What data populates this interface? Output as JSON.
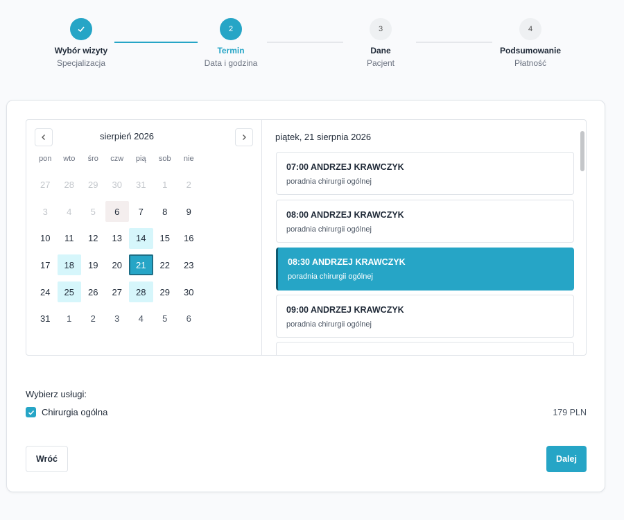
{
  "stepper": {
    "steps": [
      {
        "number": "",
        "title": "Wybór wizyty",
        "subtitle": "Specjalizacja",
        "state": "done"
      },
      {
        "number": "2",
        "title": "Termin",
        "subtitle": "Data i godzina",
        "state": "active"
      },
      {
        "number": "3",
        "title": "Dane",
        "subtitle": "Pacjent",
        "state": "pending"
      },
      {
        "number": "4",
        "title": "Podsumowanie",
        "subtitle": "Płatność",
        "state": "pending"
      }
    ]
  },
  "calendar": {
    "month_label": "sierpień 2026",
    "weekdays": [
      "pon",
      "wto",
      "śro",
      "czw",
      "pią",
      "sob",
      "nie"
    ],
    "weeks": [
      [
        "27",
        "28",
        "29",
        "30",
        "31",
        "1",
        "2"
      ],
      [
        "3",
        "4",
        "5",
        "6",
        "7",
        "8",
        "9"
      ],
      [
        "10",
        "11",
        "12",
        "13",
        "14",
        "15",
        "16"
      ],
      [
        "17",
        "18",
        "19",
        "20",
        "21",
        "22",
        "23"
      ],
      [
        "24",
        "25",
        "26",
        "27",
        "28",
        "29",
        "30"
      ],
      [
        "31",
        "1",
        "2",
        "3",
        "4",
        "5",
        "6"
      ]
    ]
  },
  "slots": {
    "date_label": "piątek, 21 sierpnia 2026",
    "items": [
      {
        "time": "07:00 ANDRZEJ KRAWCZYK",
        "desc": "poradnia chirurgii ogólnej"
      },
      {
        "time": "08:00 ANDRZEJ KRAWCZYK",
        "desc": "poradnia chirurgii ogólnej"
      },
      {
        "time": "08:30 ANDRZEJ KRAWCZYK",
        "desc": "poradnia chirurgii ogólnej",
        "selected": true
      },
      {
        "time": "09:00 ANDRZEJ KRAWCZYK",
        "desc": "poradnia chirurgii ogólnej"
      }
    ]
  },
  "services": {
    "label": "Wybierz usługi:",
    "items": [
      {
        "name": "Chirurgia ogólna",
        "price": "179 PLN",
        "checked": true
      }
    ]
  },
  "actions": {
    "back_label": "Wróć",
    "next_label": "Dalej"
  },
  "colors": {
    "accent": "#26a5c6",
    "available_day": "#d6f6fb"
  }
}
